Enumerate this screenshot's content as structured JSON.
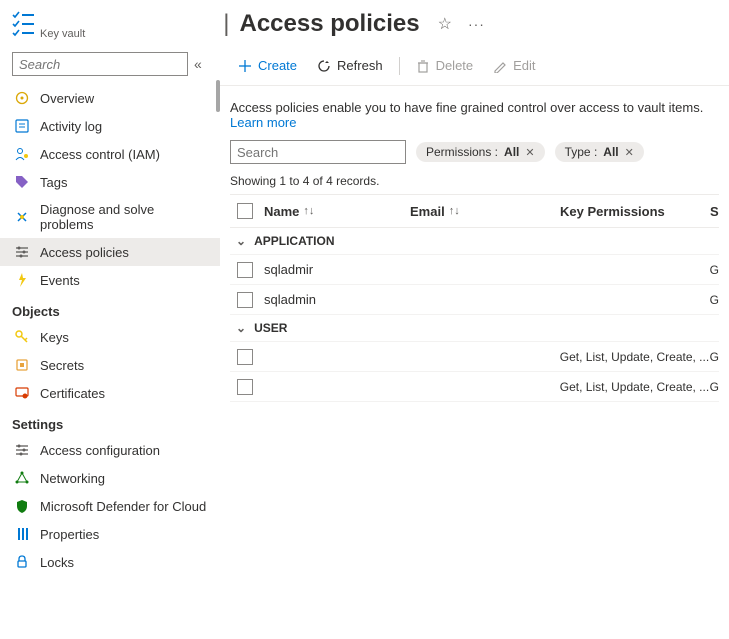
{
  "header": {
    "resource_type": "Key vault",
    "title": "Access policies"
  },
  "sidebar": {
    "search_placeholder": "Search",
    "items": [
      {
        "label": "Overview",
        "icon": "overview",
        "color": "#dba808"
      },
      {
        "label": "Activity log",
        "icon": "activity",
        "color": "#0078d4"
      },
      {
        "label": "Access control (IAM)",
        "icon": "access-control",
        "color": "#0078d4"
      },
      {
        "label": "Tags",
        "icon": "tags",
        "color": "#8661c5"
      },
      {
        "label": "Diagnose and solve problems",
        "icon": "diagnose",
        "color": "#0078d4"
      },
      {
        "label": "Access policies",
        "icon": "access-policies",
        "color": "#605e5c",
        "active": true
      },
      {
        "label": "Events",
        "icon": "events",
        "color": "#f2c811"
      }
    ],
    "objects_label": "Objects",
    "objects": [
      {
        "label": "Keys",
        "icon": "keys",
        "color": "#f2c811"
      },
      {
        "label": "Secrets",
        "icon": "secrets",
        "color": "#e8a33d"
      },
      {
        "label": "Certificates",
        "icon": "certificates",
        "color": "#d83b01"
      }
    ],
    "settings_label": "Settings",
    "settings": [
      {
        "label": "Access configuration",
        "icon": "access-config",
        "color": "#605e5c"
      },
      {
        "label": "Networking",
        "icon": "networking",
        "color": "#107c10"
      },
      {
        "label": "Microsoft Defender for Cloud",
        "icon": "defender",
        "color": "#107c10"
      },
      {
        "label": "Properties",
        "icon": "properties",
        "color": "#0078d4"
      },
      {
        "label": "Locks",
        "icon": "locks",
        "color": "#0078d4"
      }
    ]
  },
  "toolbar": {
    "create": "Create",
    "refresh": "Refresh",
    "delete": "Delete",
    "edit": "Edit"
  },
  "main": {
    "description": "Access policies enable you to have fine grained control over access to vault items. ",
    "learn_more": "Learn more",
    "search_placeholder": "Search",
    "filters": [
      {
        "label": "Permissions :",
        "value": "All"
      },
      {
        "label": "Type :",
        "value": "All"
      }
    ],
    "showing": "Showing 1 to 4 of 4 records.",
    "columns": {
      "name": "Name",
      "email": "Email",
      "key_permissions": "Key Permissions",
      "secret_permissions": "S"
    },
    "groups": [
      {
        "label": "APPLICATION",
        "rows": [
          {
            "name": "sqladmir",
            "email": "",
            "key_permissions": "",
            "secret_permissions": "G"
          },
          {
            "name": "sqladmin",
            "email": "",
            "key_permissions": "",
            "secret_permissions": "G"
          }
        ]
      },
      {
        "label": "USER",
        "rows": [
          {
            "name": "",
            "email": "",
            "key_permissions": "Get, List, Update, Create, ...",
            "secret_permissions": "G"
          },
          {
            "name": "",
            "email": "",
            "key_permissions": "Get, List, Update, Create, ...",
            "secret_permissions": "G"
          }
        ]
      }
    ]
  }
}
